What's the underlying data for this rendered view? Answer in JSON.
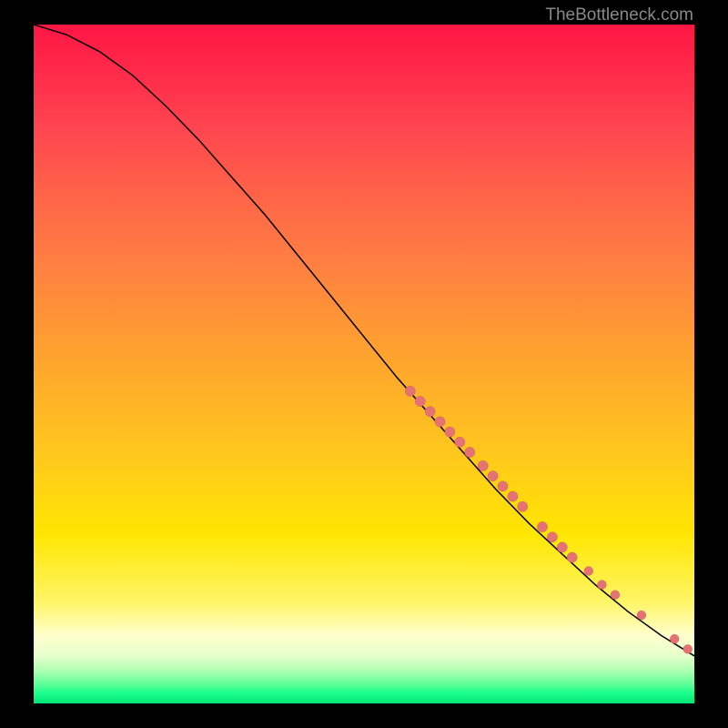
{
  "watermark": "TheBottleneck.com",
  "chart_data": {
    "type": "line",
    "title": "",
    "xlabel": "",
    "ylabel": "",
    "xlim": [
      0,
      100
    ],
    "ylim": [
      0,
      100
    ],
    "curve": [
      {
        "x": 0,
        "y": 100
      },
      {
        "x": 5,
        "y": 98.5
      },
      {
        "x": 10,
        "y": 96
      },
      {
        "x": 15,
        "y": 92.5
      },
      {
        "x": 20,
        "y": 88
      },
      {
        "x": 25,
        "y": 83
      },
      {
        "x": 30,
        "y": 77.5
      },
      {
        "x": 35,
        "y": 72
      },
      {
        "x": 40,
        "y": 66
      },
      {
        "x": 45,
        "y": 60
      },
      {
        "x": 50,
        "y": 54
      },
      {
        "x": 55,
        "y": 48
      },
      {
        "x": 60,
        "y": 42.5
      },
      {
        "x": 65,
        "y": 37
      },
      {
        "x": 70,
        "y": 31.5
      },
      {
        "x": 75,
        "y": 26.5
      },
      {
        "x": 80,
        "y": 22
      },
      {
        "x": 85,
        "y": 17.5
      },
      {
        "x": 90,
        "y": 13.5
      },
      {
        "x": 95,
        "y": 10
      },
      {
        "x": 100,
        "y": 7
      }
    ],
    "highlighted_points": [
      {
        "x": 57,
        "y": 46,
        "r": 4
      },
      {
        "x": 58.5,
        "y": 44.5,
        "r": 4
      },
      {
        "x": 60,
        "y": 43,
        "r": 4
      },
      {
        "x": 61.5,
        "y": 41.5,
        "r": 4
      },
      {
        "x": 63,
        "y": 40,
        "r": 4
      },
      {
        "x": 64.5,
        "y": 38.5,
        "r": 4
      },
      {
        "x": 66,
        "y": 37,
        "r": 4
      },
      {
        "x": 68,
        "y": 35,
        "r": 4
      },
      {
        "x": 69.5,
        "y": 33.5,
        "r": 4
      },
      {
        "x": 71,
        "y": 32,
        "r": 4
      },
      {
        "x": 72.5,
        "y": 30.5,
        "r": 4
      },
      {
        "x": 74,
        "y": 29,
        "r": 4
      },
      {
        "x": 77,
        "y": 26,
        "r": 4
      },
      {
        "x": 78.5,
        "y": 24.5,
        "r": 4
      },
      {
        "x": 80,
        "y": 23,
        "r": 4
      },
      {
        "x": 81.5,
        "y": 21.5,
        "r": 4
      },
      {
        "x": 84,
        "y": 19.5,
        "r": 3.5
      },
      {
        "x": 86,
        "y": 17.5,
        "r": 3.5
      },
      {
        "x": 88,
        "y": 16,
        "r": 3.5
      },
      {
        "x": 92,
        "y": 13,
        "r": 3.5
      },
      {
        "x": 97,
        "y": 9.5,
        "r": 3.5
      },
      {
        "x": 99,
        "y": 8,
        "r": 3.5
      }
    ]
  }
}
